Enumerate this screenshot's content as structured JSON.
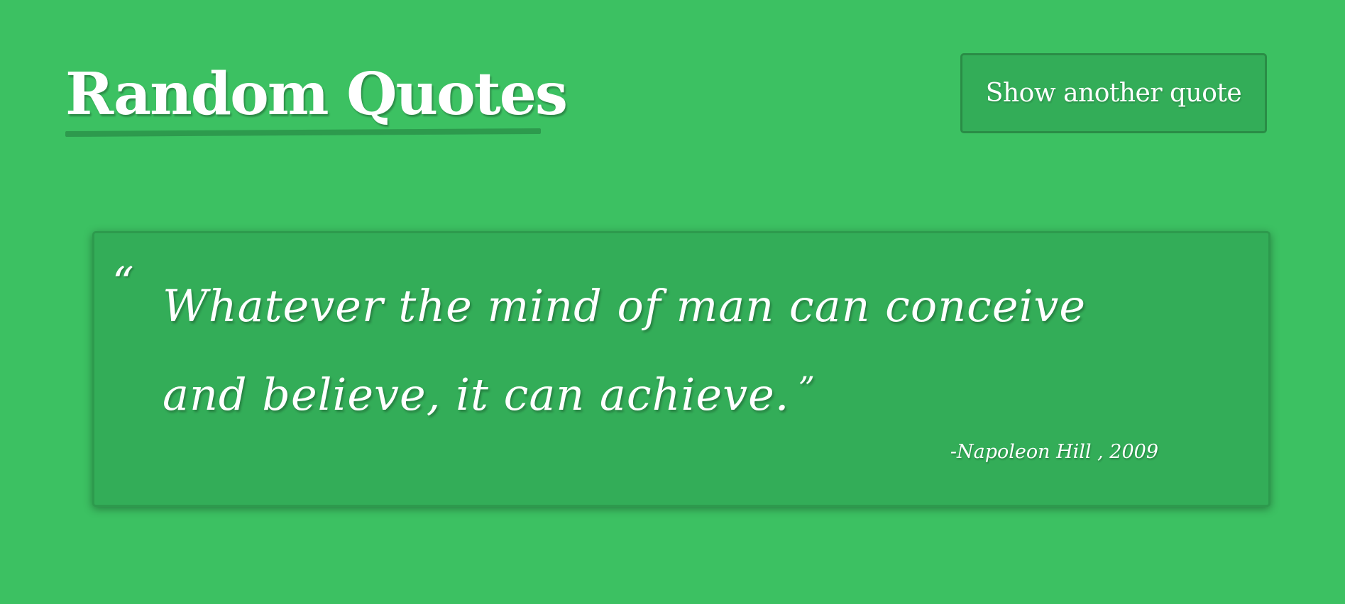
{
  "header": {
    "title": "Random Quotes",
    "button_label": "Show another quote"
  },
  "quote": {
    "open_mark": "“",
    "text": "Whatever the mind of man can conceive and believe, it can achieve.",
    "close_mark": "”",
    "author_line": "-Napoleon Hill , 2009"
  },
  "colors": {
    "background": "#3cc162",
    "card": "#33ad58",
    "accent_dark": "#2d9a4d",
    "text": "#ffffff"
  }
}
